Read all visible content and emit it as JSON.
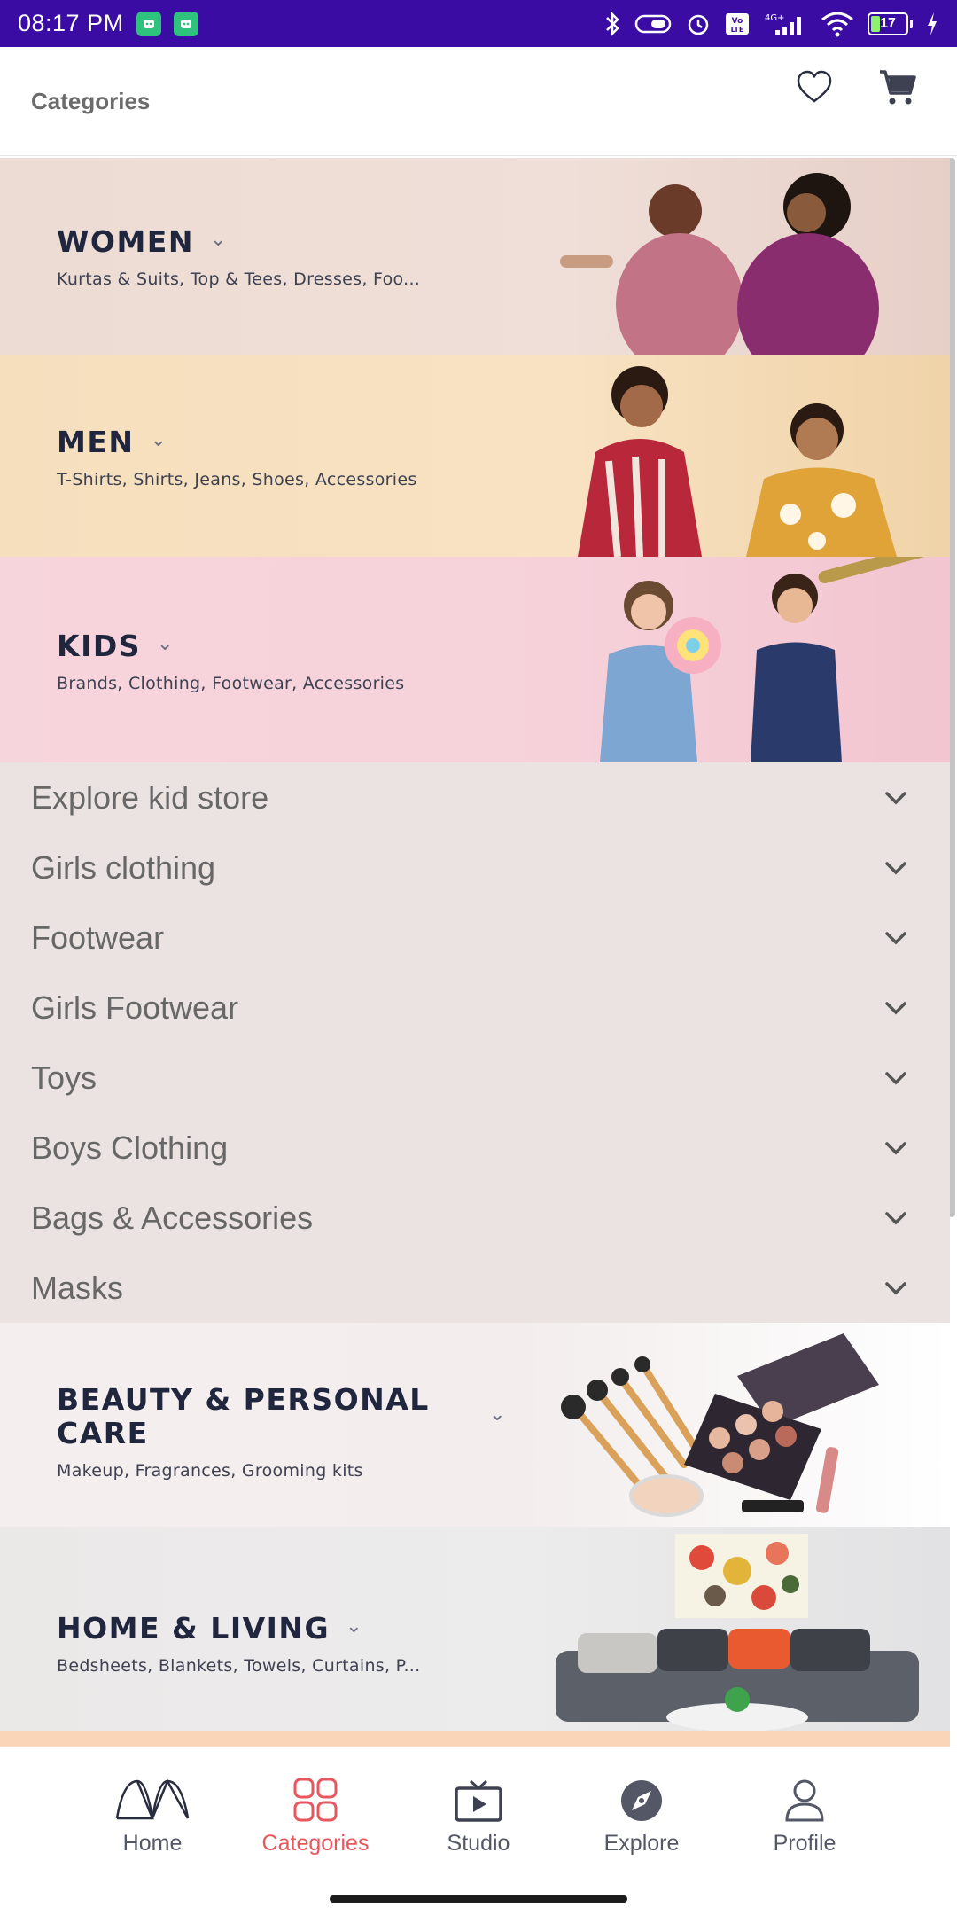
{
  "status_bar": {
    "time": "08:17 PM",
    "network": "4G+",
    "volte": "Vo LTE",
    "battery": "17"
  },
  "header": {
    "title": "Categories"
  },
  "categories": [
    {
      "title": "WOMEN",
      "subtitle": "Kurtas & Suits, Top & Tees, Dresses, Foo..."
    },
    {
      "title": "MEN",
      "subtitle": "T-Shirts, Shirts, Jeans, Shoes, Accessories"
    },
    {
      "title": "KIDS",
      "subtitle": "Brands, Clothing, Footwear, Accessories"
    },
    {
      "title": "BEAUTY & PERSONAL CARE",
      "subtitle": "Makeup, Fragrances, Grooming kits"
    },
    {
      "title": "HOME & LIVING",
      "subtitle": "Bedsheets, Blankets, Towels, Curtains, P..."
    }
  ],
  "kids_subcategories": [
    "Explore kid store",
    "Girls clothing",
    "Footwear",
    "Girls Footwear",
    "Toys",
    "Boys Clothing",
    "Bags & Accessories",
    "Masks"
  ],
  "bottom_nav": [
    {
      "label": "Home",
      "icon": "myntra-logo-icon"
    },
    {
      "label": "Categories",
      "icon": "grid-icon",
      "active": true
    },
    {
      "label": "Studio",
      "icon": "tv-icon"
    },
    {
      "label": "Explore",
      "icon": "compass-icon"
    },
    {
      "label": "Profile",
      "icon": "person-icon"
    }
  ],
  "colors": {
    "status_bar": "#3a0ca3",
    "active_tab": "#e8565e",
    "title_text": "#20263e"
  }
}
